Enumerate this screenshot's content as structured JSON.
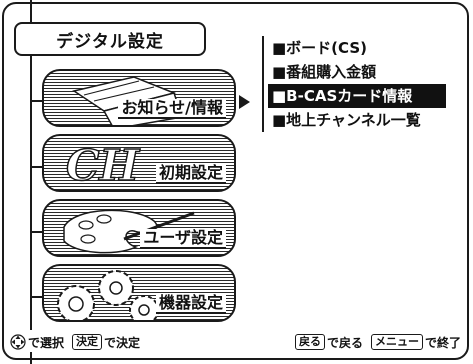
{
  "title": "デジタル設定",
  "menu": [
    {
      "label": "お知らせ/情報",
      "selected": true,
      "art": "envelope"
    },
    {
      "label": "初期設定",
      "selected": false,
      "art": "ch-letters"
    },
    {
      "label": "ユーザ設定",
      "selected": false,
      "art": "palette"
    },
    {
      "label": "機器設定",
      "selected": false,
      "art": "gears"
    }
  ],
  "submenu": [
    {
      "label": "■ボード(CS)",
      "selected": false
    },
    {
      "label": "■番組購入金額",
      "selected": false
    },
    {
      "label": "■B-CASカード情報",
      "selected": true
    },
    {
      "label": "■地上チャンネル一覧",
      "selected": false
    }
  ],
  "footer": {
    "select_text": "で選択",
    "enter_key": "決定",
    "enter_text": "で決定",
    "back_key": "戻る",
    "back_text": "で戻る",
    "menu_key": "メニュー",
    "menu_text": "で終了"
  },
  "icons": {
    "dpad": "dpad-icon",
    "arrow": "arrow-right-icon"
  }
}
